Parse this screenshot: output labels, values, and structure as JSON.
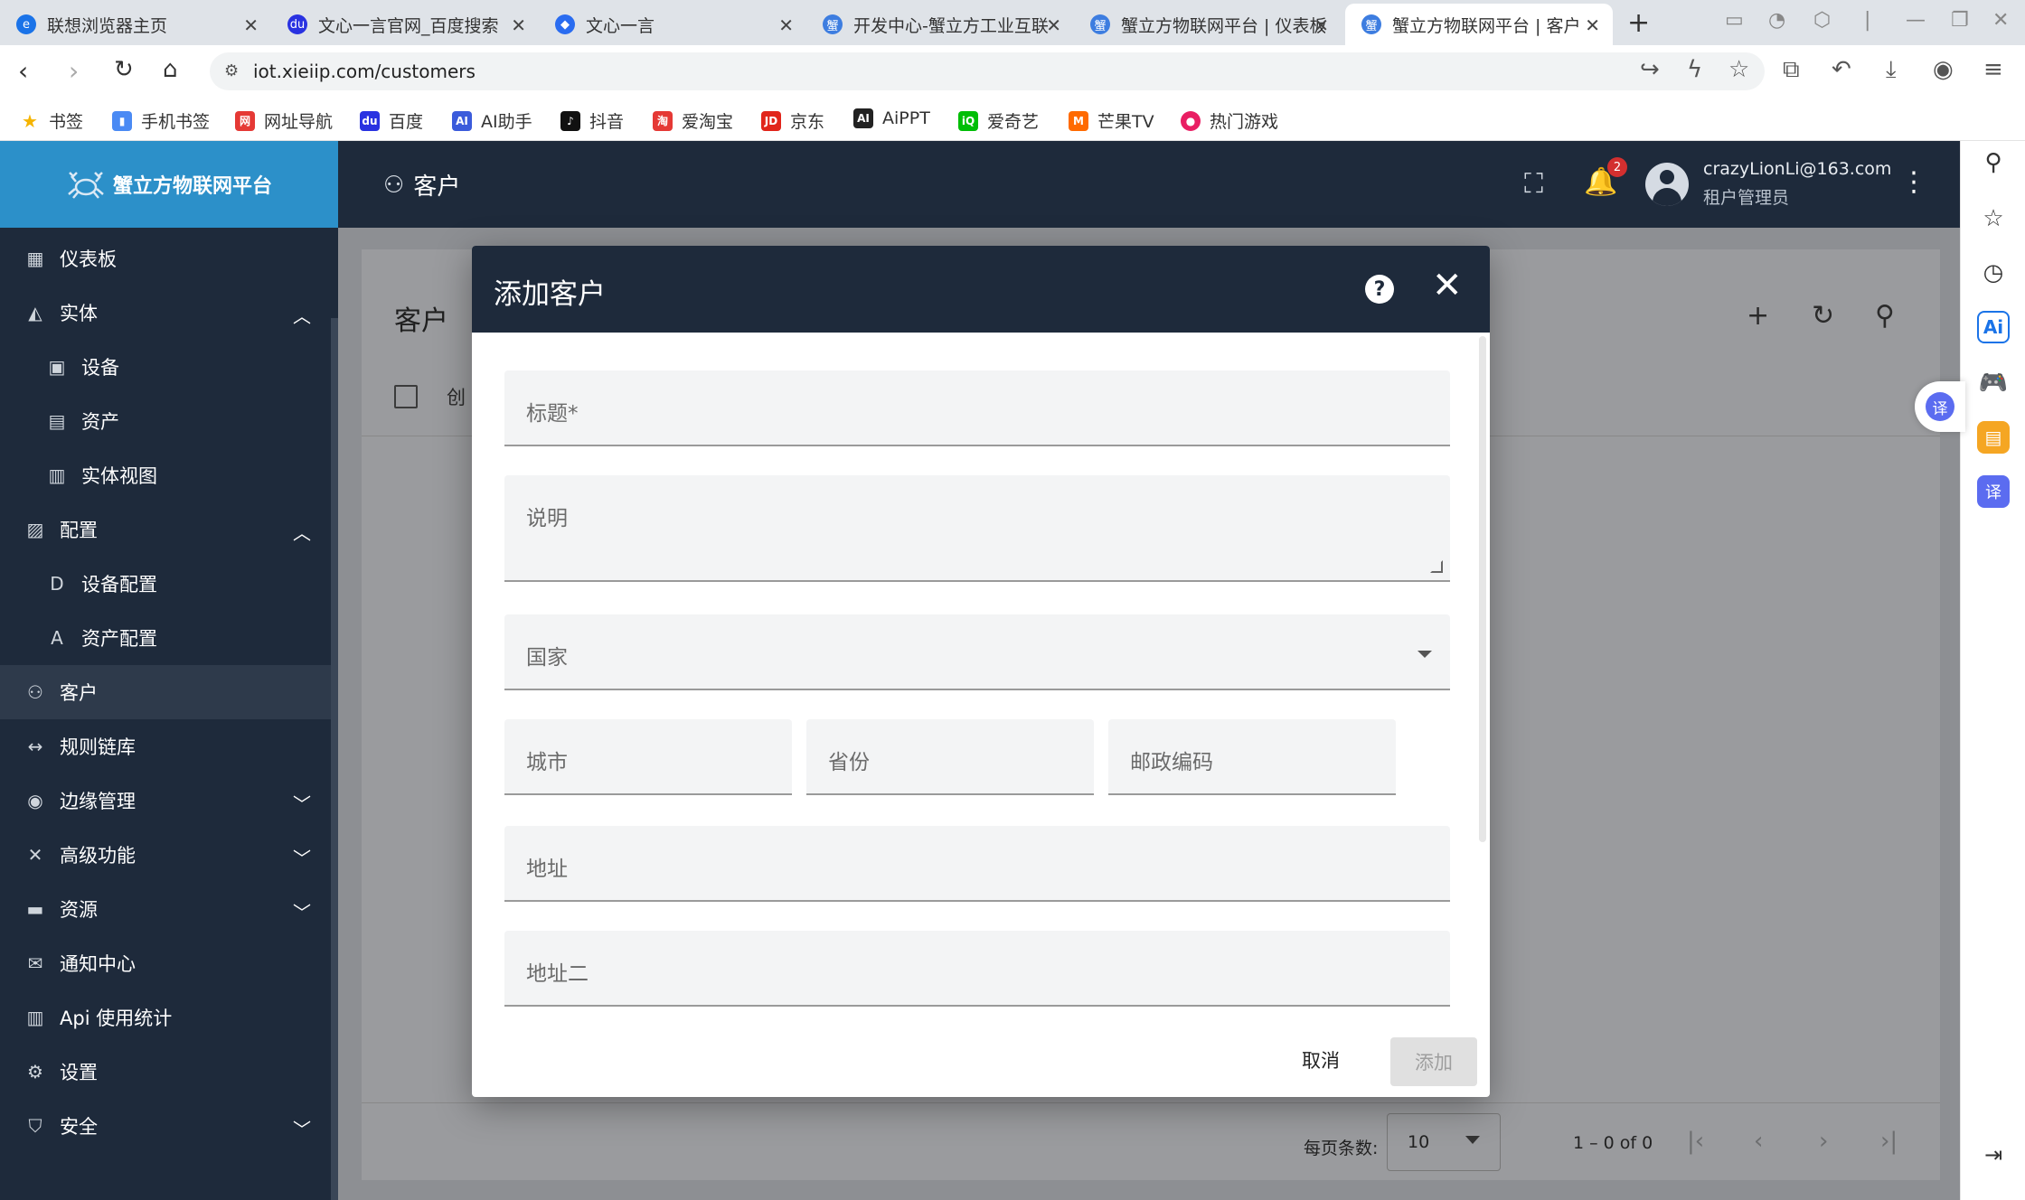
{
  "browser": {
    "tabs": [
      {
        "title": "联想浏览器主页",
        "color": "#1a73e8",
        "glyph": "e"
      },
      {
        "title": "文心一言官网_百度搜索",
        "color": "#2932e1",
        "glyph": "du"
      },
      {
        "title": "文心一言",
        "color": "#2a6cf0",
        "glyph": "◆"
      },
      {
        "title": "开发中心-蟹立方工业互联",
        "color": "#3d7de0",
        "glyph": "蟹"
      },
      {
        "title": "蟹立方物联网平台 | 仪表板",
        "color": "#3d7de0",
        "glyph": "蟹"
      },
      {
        "title": "蟹立方物联网平台 | 客户",
        "color": "#3d7de0",
        "glyph": "蟹"
      }
    ],
    "url": "iot.xieiip.com/customers",
    "bookmarks": [
      {
        "label": "书签",
        "color": "#f5b400",
        "glyph": "★"
      },
      {
        "label": "手机书签",
        "color": "#4a8af4",
        "glyph": "▮"
      },
      {
        "label": "网址导航",
        "color": "#e53935",
        "glyph": "网"
      },
      {
        "label": "百度",
        "color": "#2932e1",
        "glyph": "du"
      },
      {
        "label": "AI助手",
        "color": "#3b5bdb",
        "glyph": "AI"
      },
      {
        "label": "抖音",
        "color": "#111111",
        "glyph": "♪"
      },
      {
        "label": "爱淘宝",
        "color": "#e53935",
        "glyph": "淘"
      },
      {
        "label": "京东",
        "color": "#e1251b",
        "glyph": "JD"
      },
      {
        "label": "AiPPT",
        "color": "#222222",
        "glyph": "AI"
      },
      {
        "label": "爱奇艺",
        "color": "#00be06",
        "glyph": "iQ"
      },
      {
        "label": "芒果TV",
        "color": "#ff6a00",
        "glyph": "M"
      },
      {
        "label": "热门游戏",
        "color": "#e91e63",
        "glyph": "●"
      }
    ]
  },
  "app": {
    "brand": "蟹立方物联网平台",
    "page_title": "客户",
    "notification_count": "2",
    "user_email": "crazyLionLi@163.com",
    "user_role": "租户管理员"
  },
  "sidebar": {
    "items": [
      {
        "label": "仪表板",
        "icon": "dashboard-icon",
        "glyph": "▦",
        "chevron": ""
      },
      {
        "label": "实体",
        "icon": "entities-icon",
        "glyph": "◭",
        "chevron": "︿"
      },
      {
        "label": "设备",
        "icon": "device-icon",
        "glyph": "▣",
        "chevron": "",
        "sub": true
      },
      {
        "label": "资产",
        "icon": "asset-icon",
        "glyph": "▤",
        "chevron": "",
        "sub": true
      },
      {
        "label": "实体视图",
        "icon": "entity-view-icon",
        "glyph": "▥",
        "chevron": "",
        "sub": true
      },
      {
        "label": "配置",
        "icon": "profiles-icon",
        "glyph": "▨",
        "chevron": "︿"
      },
      {
        "label": "设备配置",
        "icon": "device-profile-icon",
        "glyph": "D",
        "chevron": "",
        "sub": true
      },
      {
        "label": "资产配置",
        "icon": "asset-profile-icon",
        "glyph": "A",
        "chevron": "",
        "sub": true
      },
      {
        "label": "客户",
        "icon": "customers-icon",
        "glyph": "👥",
        "chevron": "",
        "active": true
      },
      {
        "label": "规则链库",
        "icon": "rule-chain-icon",
        "glyph": "↔",
        "chevron": ""
      },
      {
        "label": "边缘管理",
        "icon": "edge-icon",
        "glyph": "◉",
        "chevron": "﹀"
      },
      {
        "label": "高级功能",
        "icon": "advanced-icon",
        "glyph": "✕",
        "chevron": "﹀"
      },
      {
        "label": "资源",
        "icon": "folder-icon",
        "glyph": "▬",
        "chevron": "﹀"
      },
      {
        "label": "通知中心",
        "icon": "notification-center-icon",
        "glyph": "✉",
        "chevron": ""
      },
      {
        "label": "Api 使用统计",
        "icon": "api-usage-icon",
        "glyph": "▥",
        "chevron": ""
      },
      {
        "label": "设置",
        "icon": "settings-icon",
        "glyph": "⚙",
        "chevron": ""
      },
      {
        "label": "安全",
        "icon": "security-icon",
        "glyph": "⛉",
        "chevron": "﹀"
      }
    ]
  },
  "customers_card": {
    "title": "客户",
    "column_created": "创",
    "page_size_label": "每页条数:",
    "page_size": "10",
    "range": "1 – 0 of 0"
  },
  "dialog": {
    "title": "添加客户",
    "fields": {
      "title_placeholder": "标题*",
      "description_placeholder": "说明",
      "country_placeholder": "国家",
      "city_placeholder": "城市",
      "state_placeholder": "省份",
      "zip_placeholder": "邮政编码",
      "address_placeholder": "地址",
      "address2_placeholder": "地址二"
    },
    "cancel_label": "取消",
    "add_label": "添加"
  }
}
